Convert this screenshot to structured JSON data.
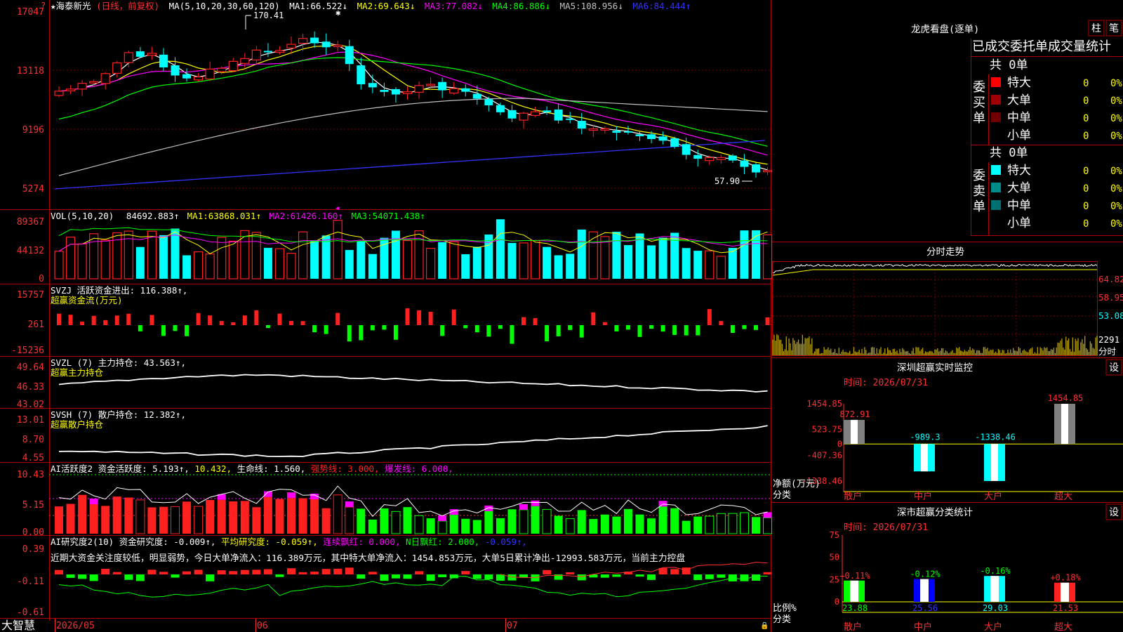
{
  "app": {
    "brand": "大智慧",
    "marker": "?"
  },
  "header": {
    "stock": "★海泰新光",
    "mode": "(日线，前复权)",
    "ma_prefix": "MA(5,10,20,30,60,120)",
    "mas": [
      {
        "label": "MA1:",
        "value": "66.522↓",
        "color": "#ffffff"
      },
      {
        "label": "MA2:",
        "value": "69.643↓",
        "color": "#ffff00"
      },
      {
        "label": "MA3:",
        "value": "77.082↓",
        "color": "#ff00ff"
      },
      {
        "label": "MA4:",
        "value": "86.886↓",
        "color": "#00ff00"
      },
      {
        "label": "MA5:",
        "value": "108.956↓",
        "color": "#c0c0c0"
      },
      {
        "label": "MA6:",
        "value": "84.444↑",
        "color": "#3333ff"
      }
    ]
  },
  "price_panel": {
    "y_ticks": [
      "17047",
      "13118",
      "9196",
      "5274"
    ],
    "high_label": "170.41",
    "low_label": "57.90"
  },
  "vol_panel": {
    "title": "VOL(5,10,20)",
    "value": "84692.883↑",
    "mas": [
      {
        "label": "MA1:",
        "value": "63868.031↑",
        "color": "#ffff00"
      },
      {
        "label": "MA2:",
        "value": "61426.160↑",
        "color": "#ff00ff"
      },
      {
        "label": "MA3:",
        "value": "54071.438↑",
        "color": "#00ff00"
      }
    ],
    "y_ticks": [
      "89367",
      "44132",
      "0"
    ]
  },
  "svzj_panel": {
    "title": "SVZJ  活跃资金进出: 116.388↑,",
    "subtitle": "超赢资金流(万元)",
    "y_ticks": [
      "15757",
      "261",
      "-15236"
    ]
  },
  "svzl_panel": {
    "title": "SVZL (7) 主力持仓: 43.563↑,",
    "subtitle": "超赢主力持仓",
    "y_ticks": [
      "49.64",
      "46.33",
      "43.02"
    ]
  },
  "svsh_panel": {
    "title": "SVSH (7) 散户持仓: 12.382↑,",
    "subtitle": "超赢散户持仓",
    "y_ticks": [
      "13.01",
      "8.70",
      "4.55"
    ]
  },
  "ai1_panel": {
    "title_a": "AI活跃度2 资金活跃度: 5.193↑,",
    "title_b": "10.432,",
    "title_c": "生命线: 1.560,",
    "title_d": "强势线: 3.000,",
    "title_e": "爆发线: 6.000,",
    "y_ticks": [
      "10.43",
      "5.15",
      "0.00"
    ]
  },
  "ai2_panel": {
    "title_a": "AI研究度2(10) 资金研究度: -0.009↑,",
    "title_b": "平均研究度: -0.059↑,",
    "title_c": "连续飘红: 0.000,",
    "title_d": "N日飘红: 2.000,",
    "title_e": "-0.059↑,",
    "comment": "近期大资金关注度较低，明显弱势，今日大单净流入：116.389万元，其中特大单净流入：1454.853万元，大单5日累计净出-12993.583万元，当前主力控盘",
    "y_ticks": [
      "0.39",
      "-0.11",
      "-0.61"
    ]
  },
  "x_axis": [
    "2026/05",
    "06",
    "07"
  ],
  "dragon": {
    "title": "龙虎看盘(逐单)",
    "btn_bar": "柱",
    "btn_pen": "笔",
    "header": "已成交委托单成交量统计",
    "buy_label": [
      "委",
      "买",
      "单"
    ],
    "sell_label": [
      "委",
      "卖",
      "单"
    ],
    "buy_total": "共 0单",
    "sell_total": "共 0单",
    "buy_rows": [
      {
        "name": "特大",
        "count": "0",
        "pct": "0%",
        "color": "#ff0000"
      },
      {
        "name": "大单",
        "count": "0",
        "pct": "0%",
        "color": "#a00000"
      },
      {
        "name": "中单",
        "count": "0",
        "pct": "0%",
        "color": "#700000"
      },
      {
        "name": "小单",
        "count": "0",
        "pct": "0%",
        "color": ""
      }
    ],
    "sell_rows": [
      {
        "name": "特大",
        "count": "0",
        "pct": "0%",
        "color": "#00ffff"
      },
      {
        "name": "大单",
        "count": "0",
        "pct": "0%",
        "color": "#008b8b"
      },
      {
        "name": "中单",
        "count": "0",
        "pct": "0%",
        "color": "#007070"
      },
      {
        "name": "小单",
        "count": "0",
        "pct": "0%",
        "color": ""
      }
    ]
  },
  "intraday": {
    "title": "分时走势",
    "price_ticks": [
      "64.82",
      "58.95",
      "53.08"
    ],
    "vol_tick": "2291",
    "vol_unit": "分时"
  },
  "sz_monitor": {
    "title": "深圳超赢实时监控",
    "settings": "设",
    "time": "时间: 2026/07/31",
    "y_ticks": [
      "1454.85",
      "523.75",
      "0",
      "-407.36",
      "-1338.46"
    ],
    "unit": "净额(万元)",
    "cat_label": "分类",
    "categories": [
      "散户",
      "中户",
      "大户",
      "超大"
    ],
    "values": [
      872.91,
      -989.3,
      -1338.46,
      1454.85
    ],
    "value_labels": [
      "872.91",
      "-989.3",
      "-1338.46",
      "1454.85"
    ]
  },
  "sz_class": {
    "title": "深市超赢分类统计",
    "settings": "设",
    "time": "时间: 2026/07/31",
    "y_ticks": [
      "75",
      "50",
      "25",
      "0"
    ],
    "unit": "比例%",
    "cat_label": "分类",
    "categories": [
      "散户",
      "中户",
      "大户",
      "超大"
    ],
    "values": [
      23.88,
      25.56,
      29.03,
      21.53
    ],
    "changes": [
      "+0.11%",
      "-0.12%",
      "-0.16%",
      "+0.18%"
    ]
  },
  "colors": {
    "up": "#ff2020",
    "down": "#00ffff",
    "grid": "#a00000",
    "axis": "#ff3030"
  },
  "chart_data": {
    "type": "bar",
    "title": "深圳超赢实时监控",
    "categories": [
      "散户",
      "中户",
      "大户",
      "超大"
    ],
    "values": [
      872.91,
      -989.3,
      -1338.46,
      1454.85
    ],
    "ylabel": "净额(万元)",
    "ylim": [
      -1338.46,
      1454.85
    ]
  }
}
